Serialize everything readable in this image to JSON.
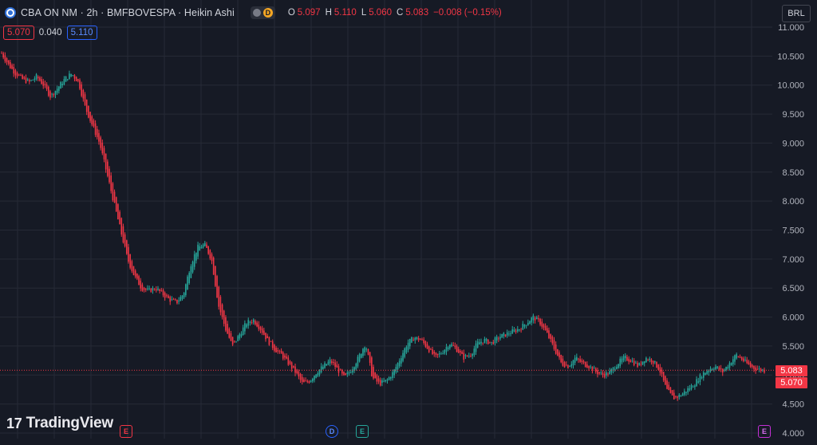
{
  "header": {
    "symbol": "CBA ON NM · 2h · BMFBOVESPA · Heikin Ashi",
    "d_badge": "D",
    "ohlc": {
      "o_label": "O",
      "o_value": "5.097",
      "h_label": "H",
      "h_value": "5.110",
      "l_label": "L",
      "l_value": "5.060",
      "c_label": "C",
      "c_value": "5.083",
      "change": "−0.008 (−0.15%)"
    }
  },
  "price_row": {
    "bid": "5.070",
    "spread": "0.040",
    "ask": "5.110"
  },
  "currency": "BRL",
  "branding": {
    "logo_mark": "17",
    "logo_text": "TradingView"
  },
  "events": {
    "d": "D",
    "e": "E"
  },
  "price_tags": {
    "last": "5.083",
    "close": "5.070"
  },
  "colors": {
    "up": "#26a69a",
    "down": "#f23645",
    "background": "#161a25",
    "grid": "#262a36"
  },
  "chart_data": {
    "type": "candlestick",
    "style": "Heikin Ashi",
    "ylim": [
      4.0,
      11.0
    ],
    "y_ticks": [
      "11.000",
      "10.500",
      "10.000",
      "9.500",
      "9.000",
      "8.500",
      "8.000",
      "7.500",
      "7.000",
      "6.500",
      "6.000",
      "5.500",
      "5.000",
      "4.500",
      "4.000"
    ],
    "current_price": 5.083,
    "series_trend": [
      10.55,
      10.35,
      10.2,
      10.1,
      10.05,
      10.15,
      10.0,
      9.8,
      9.95,
      10.1,
      10.2,
      10.05,
      9.6,
      9.3,
      9.0,
      8.5,
      8.0,
      7.5,
      7.0,
      6.7,
      6.5,
      6.45,
      6.5,
      6.4,
      6.3,
      6.25,
      6.4,
      6.9,
      7.2,
      7.25,
      7.0,
      6.2,
      5.8,
      5.5,
      5.7,
      5.9,
      5.95,
      5.8,
      5.6,
      5.45,
      5.35,
      5.2,
      5.05,
      4.85,
      4.9,
      5.05,
      5.15,
      5.25,
      5.1,
      4.95,
      5.1,
      5.3,
      5.55,
      4.95,
      4.85,
      4.9,
      5.05,
      5.3,
      5.55,
      5.65,
      5.6,
      5.45,
      5.3,
      5.4,
      5.55,
      5.45,
      5.3,
      5.35,
      5.55,
      5.6,
      5.55,
      5.65,
      5.7,
      5.75,
      5.8,
      5.9,
      6.0,
      5.9,
      5.7,
      5.45,
      5.2,
      5.15,
      5.3,
      5.2,
      5.15,
      5.05,
      5.0,
      5.05,
      5.2,
      5.3,
      5.25,
      5.15,
      5.3,
      5.25,
      5.1,
      4.75,
      4.6,
      4.65,
      4.75,
      4.85,
      5.0,
      5.1,
      5.15,
      5.05,
      5.2,
      5.35,
      5.25,
      5.15,
      5.1,
      5.08
    ]
  }
}
